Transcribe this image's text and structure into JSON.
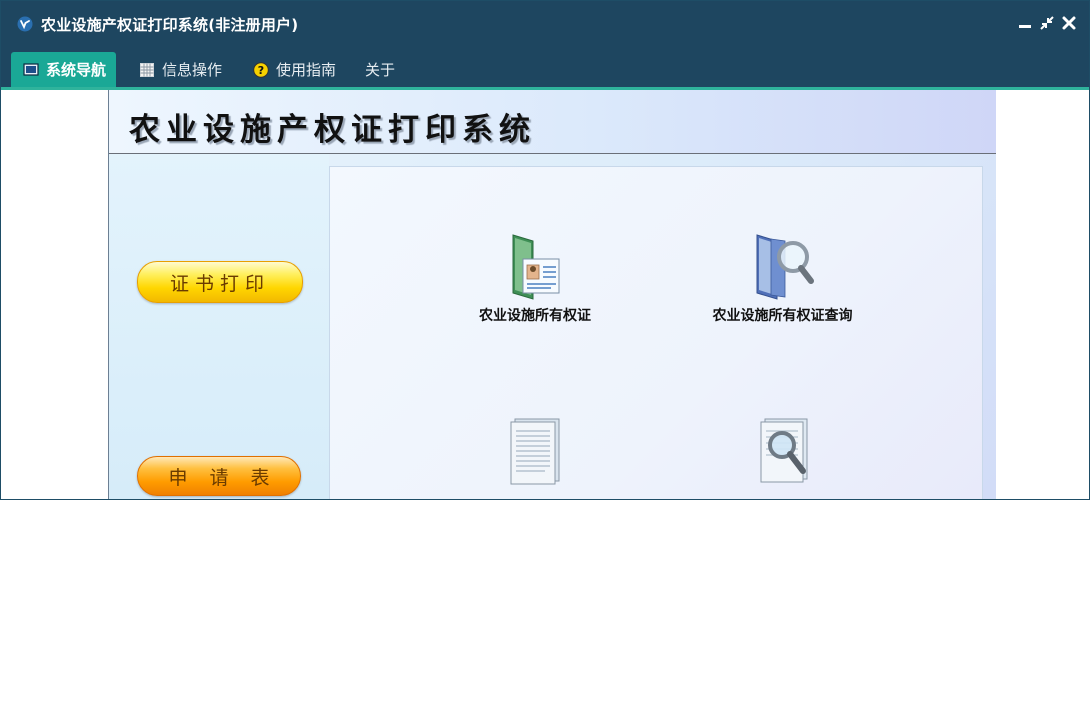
{
  "window": {
    "title": "农业设施产权证打印系统(非注册用户)"
  },
  "menu": {
    "tabs": [
      {
        "label": "系统导航",
        "icon": "monitor-icon",
        "active": true
      },
      {
        "label": "信息操作",
        "icon": "grid-icon",
        "active": false
      },
      {
        "label": "使用指南",
        "icon": "help-icon",
        "active": false
      },
      {
        "label": "关于",
        "icon": "",
        "active": false
      }
    ]
  },
  "banner": {
    "title": "农业设施产权证打印系统"
  },
  "left_nav": {
    "certificate_print": "证书打印",
    "application_form": "申请表"
  },
  "tiles": [
    {
      "label": "农业设施所有权证",
      "icon": "certificate-folder-icon"
    },
    {
      "label": "农业设施所有权证查询",
      "icon": "folder-search-icon"
    },
    {
      "label": "",
      "icon": "document-icon"
    },
    {
      "label": "",
      "icon": "document-search-icon"
    }
  ],
  "colors": {
    "titlebar": "#1e4660",
    "active_tab": "#1aa896",
    "accent_line": "#2fb39c"
  }
}
